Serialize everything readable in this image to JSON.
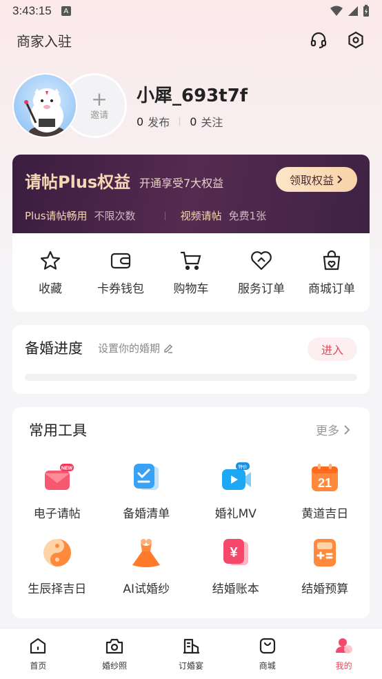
{
  "status_bar": {
    "time": "3:43:15",
    "sim_badge": "A"
  },
  "header": {
    "merchant_label": "商家入驻"
  },
  "profile": {
    "username": "小犀_693t7f",
    "invite_label": "邀请",
    "posts_count": "0",
    "posts_label": "发布",
    "following_count": "0",
    "following_label": "关注"
  },
  "plus": {
    "title": "请帖Plus权益",
    "subtitle": "开通享受7大权益",
    "claim_label": "领取权益",
    "benefit1_key": "Plus请帖畅用",
    "benefit1_value": "不限次数",
    "benefit2_key": "视频请帖",
    "benefit2_value": "免费1张",
    "colors": {
      "bg": "#3a1d3f",
      "gold": "#f6d7b6"
    }
  },
  "quick_actions": [
    {
      "label": "收藏",
      "icon": "star-icon"
    },
    {
      "label": "卡券钱包",
      "icon": "wallet-icon"
    },
    {
      "label": "购物车",
      "icon": "cart-icon"
    },
    {
      "label": "服务订单",
      "icon": "service-order-icon"
    },
    {
      "label": "商城订单",
      "icon": "mall-order-icon"
    }
  ],
  "prep": {
    "title": "备婚进度",
    "hint": "设置你的婚期",
    "enter_label": "进入"
  },
  "tools": {
    "title": "常用工具",
    "more_label": "更多",
    "items": [
      {
        "label": "电子请帖",
        "icon": "e-invitation-icon",
        "badge": "NEW"
      },
      {
        "label": "备婚清单",
        "icon": "checklist-icon"
      },
      {
        "label": "婚礼MV",
        "icon": "wedding-mv-icon",
        "badge": "特价"
      },
      {
        "label": "黄道吉日",
        "icon": "calendar-icon",
        "day": "21"
      },
      {
        "label": "生辰择吉日",
        "icon": "yin-yang-icon"
      },
      {
        "label": "AI试婚纱",
        "icon": "dress-icon"
      },
      {
        "label": "结婚账本",
        "icon": "ledger-icon",
        "symbol": "¥"
      },
      {
        "label": "结婚预算",
        "icon": "budget-calculator-icon"
      }
    ]
  },
  "tabbar": {
    "items": [
      {
        "label": "首页",
        "icon": "home-icon"
      },
      {
        "label": "婚纱照",
        "icon": "camera-icon"
      },
      {
        "label": "订婚宴",
        "icon": "banquet-icon"
      },
      {
        "label": "商城",
        "icon": "mall-icon"
      },
      {
        "label": "我的",
        "icon": "me-icon",
        "active": true
      }
    ]
  },
  "accent_color": "#e8455a"
}
